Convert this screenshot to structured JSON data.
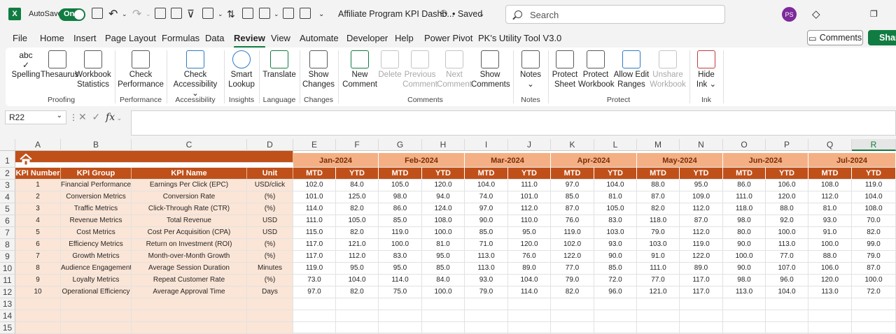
{
  "titlebar": {
    "app_logo": "X",
    "autosave_label": "AutoSave",
    "autosave_state": "On",
    "doc_title": "Affiliate Program KPI Dashb...",
    "saved_status": "• Saved",
    "search_placeholder": "Search",
    "avatar_initials": "PS"
  },
  "menu": {
    "items": [
      "File",
      "Home",
      "Insert",
      "Page Layout",
      "Formulas",
      "Data",
      "Review",
      "View",
      "Automate",
      "Developer",
      "Help",
      "Power Pivot",
      "PK's Utility Tool V3.0"
    ],
    "active": "Review",
    "comments_label": "Comments",
    "share_label": "Shar"
  },
  "ribbon": {
    "buttons": {
      "spelling": "Spelling",
      "thesaurus": "Thesaurus",
      "workbook_stats_1": "Workbook",
      "workbook_stats_2": "Statistics",
      "check_perf_1": "Check",
      "check_perf_2": "Performance",
      "check_access_1": "Check",
      "check_access_2": "Accessibility",
      "smart_lookup_1": "Smart",
      "smart_lookup_2": "Lookup",
      "translate": "Translate",
      "show_changes_1": "Show",
      "show_changes_2": "Changes",
      "new_comment_1": "New",
      "new_comment_2": "Comment",
      "delete": "Delete",
      "prev_comment_1": "Previous",
      "prev_comment_2": "Comment",
      "next_comment_1": "Next",
      "next_comment_2": "Comment",
      "show_comments_1": "Show",
      "show_comments_2": "Comments",
      "notes": "Notes",
      "protect_sheet_1": "Protect",
      "protect_sheet_2": "Sheet",
      "protect_wb_1": "Protect",
      "protect_wb_2": "Workbook",
      "allow_edit_1": "Allow Edit",
      "allow_edit_2": "Ranges",
      "unshare_1": "Unshare",
      "unshare_2": "Workbook",
      "hide_ink_1": "Hide",
      "hide_ink_2": "Ink"
    },
    "groups": {
      "proofing": "Proofing",
      "performance": "Performance",
      "accessibility": "Accessibility",
      "insights": "Insights",
      "language": "Language",
      "changes": "Changes",
      "comments": "Comments",
      "notes": "Notes",
      "protect": "Protect",
      "ink": "Ink"
    }
  },
  "formula_bar": {
    "name_box": "R22",
    "fx": "fx",
    "value": ""
  },
  "columns": [
    "A",
    "B",
    "C",
    "D",
    "E",
    "F",
    "G",
    "H",
    "I",
    "J",
    "K",
    "L",
    "M",
    "N",
    "O",
    "P",
    "Q",
    "R"
  ],
  "selected_column": "R",
  "rows": [
    "1",
    "2",
    "3",
    "4",
    "5",
    "6",
    "7",
    "8",
    "9",
    "10",
    "11",
    "12",
    "13",
    "14",
    "15"
  ],
  "sheet": {
    "headers": [
      "KPI Number",
      "KPI Group",
      "KPI Name",
      "Unit"
    ],
    "months": [
      "Jan-2024",
      "Feb-2024",
      "Mar-2024",
      "Apr-2024",
      "May-2024",
      "Jun-2024",
      "Jul-2024"
    ],
    "sub_mtd": "MTD",
    "sub_ytd": "YTD",
    "kpis": [
      {
        "num": "1",
        "group": "Financial Performance",
        "name": "Earnings Per Click (EPC)",
        "unit": "USD/click",
        "vals": [
          "102.0",
          "84.0",
          "105.0",
          "120.0",
          "104.0",
          "111.0",
          "97.0",
          "104.0",
          "88.0",
          "95.0",
          "86.0",
          "106.0",
          "108.0",
          "119.0"
        ]
      },
      {
        "num": "2",
        "group": "Conversion Metrics",
        "name": "Conversion Rate",
        "unit": "(%)",
        "vals": [
          "101.0",
          "125.0",
          "98.0",
          "94.0",
          "74.0",
          "101.0",
          "85.0",
          "81.0",
          "87.0",
          "109.0",
          "111.0",
          "120.0",
          "112.0",
          "104.0"
        ]
      },
      {
        "num": "3",
        "group": "Traffic Metrics",
        "name": "Click-Through Rate (CTR)",
        "unit": "(%)",
        "vals": [
          "114.0",
          "82.0",
          "86.0",
          "124.0",
          "97.0",
          "112.0",
          "87.0",
          "105.0",
          "82.0",
          "112.0",
          "118.0",
          "88.0",
          "81.0",
          "108.0"
        ]
      },
      {
        "num": "4",
        "group": "Revenue Metrics",
        "name": "Total Revenue",
        "unit": "USD",
        "vals": [
          "111.0",
          "105.0",
          "85.0",
          "108.0",
          "90.0",
          "110.0",
          "76.0",
          "83.0",
          "118.0",
          "87.0",
          "98.0",
          "92.0",
          "93.0",
          "70.0"
        ]
      },
      {
        "num": "5",
        "group": "Cost Metrics",
        "name": "Cost Per Acquisition (CPA)",
        "unit": "USD",
        "vals": [
          "115.0",
          "82.0",
          "119.0",
          "100.0",
          "85.0",
          "95.0",
          "119.0",
          "103.0",
          "79.0",
          "112.0",
          "80.0",
          "100.0",
          "91.0",
          "82.0"
        ]
      },
      {
        "num": "6",
        "group": "Efficiency Metrics",
        "name": "Return on Investment (ROI)",
        "unit": "(%)",
        "vals": [
          "117.0",
          "121.0",
          "100.0",
          "81.0",
          "71.0",
          "120.0",
          "102.0",
          "93.0",
          "103.0",
          "119.0",
          "90.0",
          "113.0",
          "100.0",
          "99.0"
        ]
      },
      {
        "num": "7",
        "group": "Growth Metrics",
        "name": "Month-over-Month Growth",
        "unit": "(%)",
        "vals": [
          "117.0",
          "112.0",
          "83.0",
          "95.0",
          "113.0",
          "76.0",
          "122.0",
          "90.0",
          "91.0",
          "122.0",
          "100.0",
          "77.0",
          "88.0",
          "79.0"
        ]
      },
      {
        "num": "8",
        "group": "Audience Engagement",
        "name": "Average Session Duration",
        "unit": "Minutes",
        "vals": [
          "119.0",
          "95.0",
          "95.0",
          "85.0",
          "113.0",
          "89.0",
          "77.0",
          "85.0",
          "111.0",
          "89.0",
          "90.0",
          "107.0",
          "106.0",
          "87.0"
        ]
      },
      {
        "num": "9",
        "group": "Loyalty Metrics",
        "name": "Repeat Customer Rate",
        "unit": "(%)",
        "vals": [
          "73.0",
          "104.0",
          "114.0",
          "84.0",
          "93.0",
          "104.0",
          "79.0",
          "72.0",
          "77.0",
          "117.0",
          "98.0",
          "96.0",
          "120.0",
          "100.0"
        ]
      },
      {
        "num": "10",
        "group": "Operational Efficiency",
        "name": "Average Approval Time",
        "unit": "Days",
        "vals": [
          "97.0",
          "82.0",
          "75.0",
          "100.0",
          "79.0",
          "114.0",
          "82.0",
          "96.0",
          "121.0",
          "117.0",
          "113.0",
          "104.0",
          "113.0",
          "72.0"
        ]
      }
    ]
  },
  "colors": {
    "header_dark": "#c0501a",
    "header_light": "#f4b084",
    "peach": "#fbe5d6",
    "excel_green": "#107c41"
  }
}
